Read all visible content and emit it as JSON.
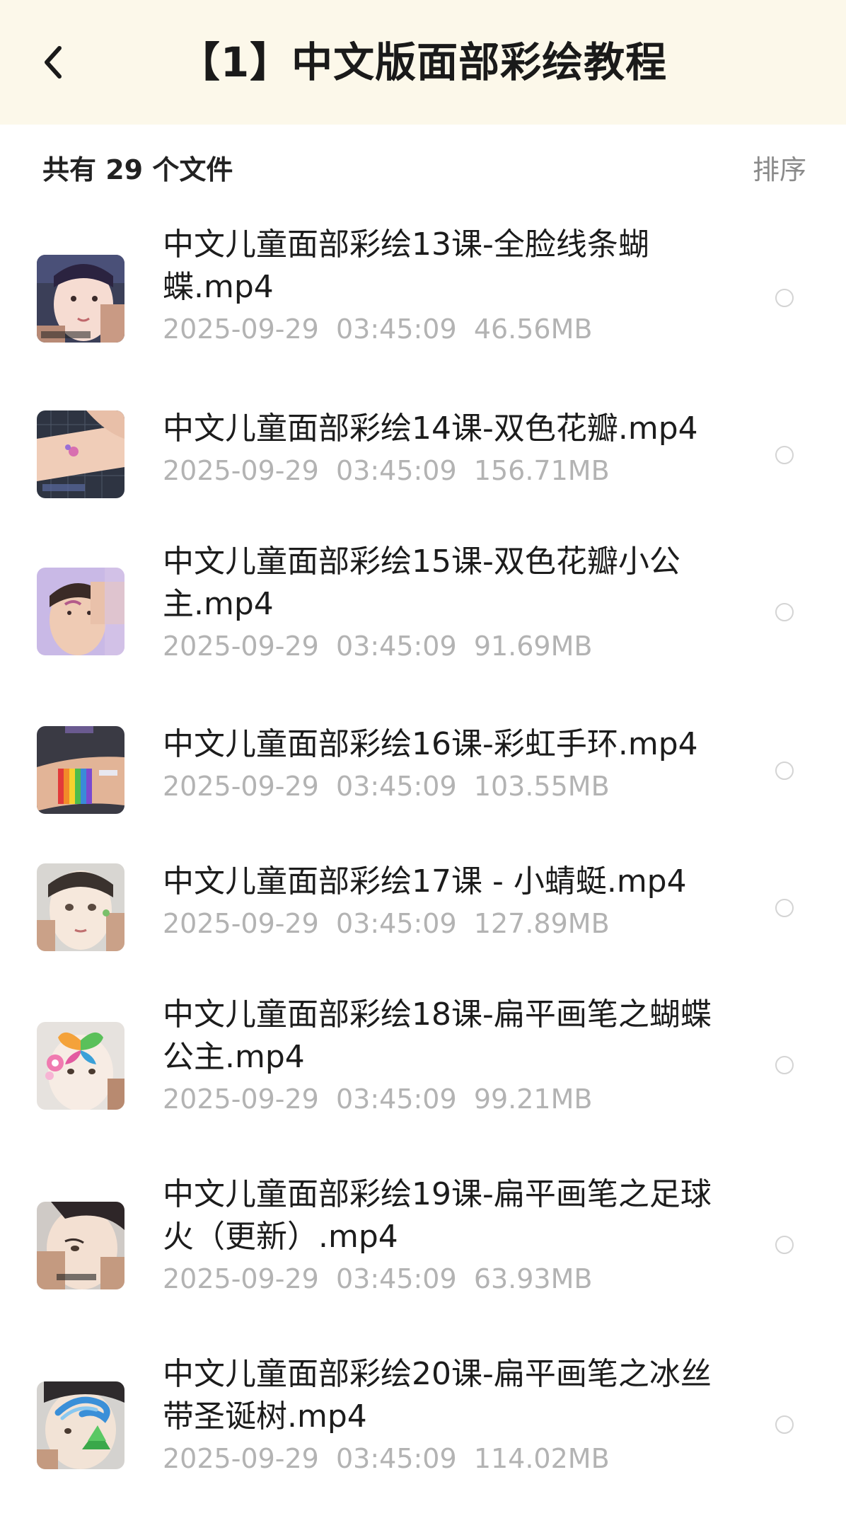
{
  "header": {
    "title": "【1】中文版面部彩绘教程",
    "back_icon": "chevron-left-icon"
  },
  "summary": {
    "count_text": "共有 29 个文件",
    "sort_label": "排序"
  },
  "files": [
    {
      "name": "中文儿童面部彩绘13课-全脸线条蝴蝶.mp4",
      "meta": "2025-09-29  03:45:09  46.56MB",
      "thumb_icon": "face-painting-video-thumbnail"
    },
    {
      "name": "中文儿童面部彩绘14课-双色花瓣.mp4",
      "meta": "2025-09-29  03:45:09  156.71MB",
      "thumb_icon": "face-painting-video-thumbnail"
    },
    {
      "name": "中文儿童面部彩绘15课-双色花瓣小公主.mp4",
      "meta": "2025-09-29  03:45:09  91.69MB",
      "thumb_icon": "face-painting-video-thumbnail"
    },
    {
      "name": "中文儿童面部彩绘16课-彩虹手环.mp4",
      "meta": "2025-09-29  03:45:09  103.55MB",
      "thumb_icon": "face-painting-video-thumbnail"
    },
    {
      "name": "中文儿童面部彩绘17课 - 小蜻蜓.mp4",
      "meta": "2025-09-29  03:45:09  127.89MB",
      "thumb_icon": "face-painting-video-thumbnail"
    },
    {
      "name": "中文儿童面部彩绘18课-扁平画笔之蝴蝶公主.mp4",
      "meta": "2025-09-29  03:45:09  99.21MB",
      "thumb_icon": "face-painting-video-thumbnail"
    },
    {
      "name": "中文儿童面部彩绘19课-扁平画笔之足球火（更新）.mp4",
      "meta": "2025-09-29  03:45:09  63.93MB",
      "thumb_icon": "face-painting-video-thumbnail"
    },
    {
      "name": "中文儿童面部彩绘20课-扁平画笔之冰丝带圣诞树.mp4",
      "meta": "2025-09-29  03:45:09  114.02MB",
      "thumb_icon": "face-painting-video-thumbnail"
    }
  ],
  "colors": {
    "header_bg": "#fcf8ea",
    "title_text": "#1a1a1a",
    "meta_text": "#b3b3b3",
    "sort_text": "#8a8a8a",
    "radio_border": "#d4d4d4"
  }
}
